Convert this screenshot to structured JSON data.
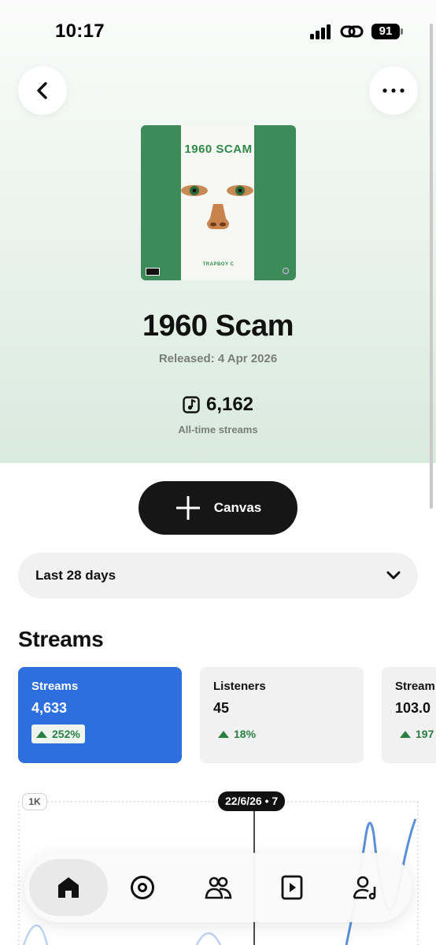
{
  "status_bar": {
    "time": "10:17",
    "battery": "91"
  },
  "header": {
    "back_icon": "chevron-left-icon",
    "more_icon": "ellipsis-icon"
  },
  "cover_art": {
    "title": "1960 SCAM",
    "artist": "TRAPBOY C"
  },
  "track": {
    "title": "1960 Scam",
    "released": "Released: 4 Apr 2026",
    "total_streams": "6,162",
    "total_streams_caption": "All-time streams"
  },
  "canvas_button": {
    "label": "Canvas"
  },
  "date_range": {
    "selected": "Last 28 days"
  },
  "section_title": "Streams",
  "stat_cards": [
    {
      "label": "Streams",
      "value": "4,633",
      "change": "252%",
      "active": true
    },
    {
      "label": "Listeners",
      "value": "45",
      "change": "18%",
      "active": false
    },
    {
      "label": "Stream",
      "value": "103.0",
      "change": "197",
      "active": false
    }
  ],
  "chart": {
    "y_tick": "1K",
    "tooltip": "22/6/26 • 7"
  },
  "nav": [
    {
      "icon": "home-icon",
      "selected": true
    },
    {
      "icon": "disc-icon",
      "selected": false
    },
    {
      "icon": "audience-icon",
      "selected": false
    },
    {
      "icon": "video-play-icon",
      "selected": false
    },
    {
      "icon": "artist-profile-icon",
      "selected": false
    }
  ],
  "colors": {
    "accent_blue": "#2E6FE0",
    "positive_green": "#2A7F43",
    "cover_green": "#3E8B5A",
    "dark_button": "#161616"
  }
}
